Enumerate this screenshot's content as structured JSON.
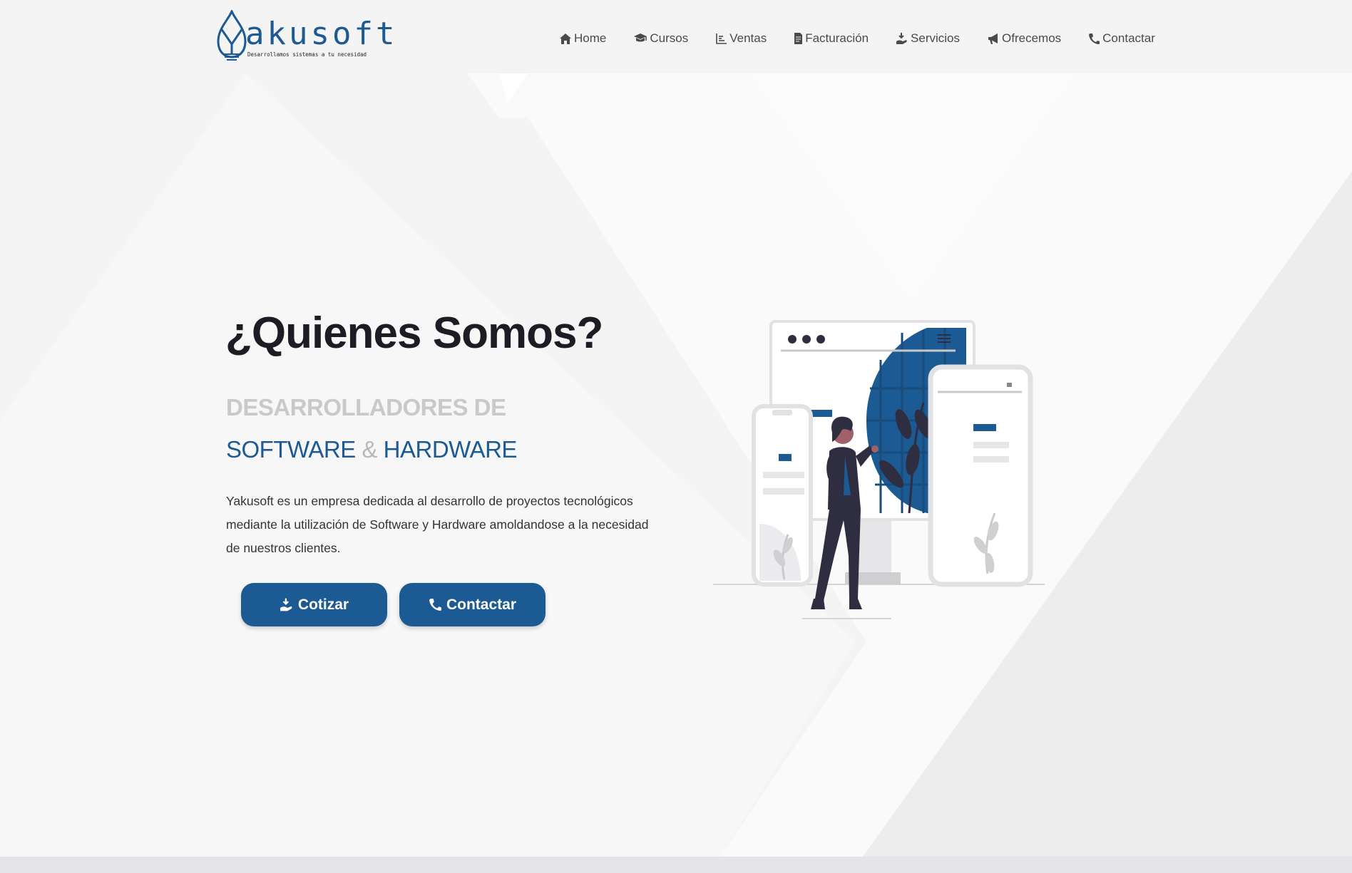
{
  "brand": {
    "name": "akusoft",
    "tagline": "Desarrollamos sistemas a tu necesidad"
  },
  "nav": {
    "items": [
      {
        "label": "Home",
        "icon": "home-icon"
      },
      {
        "label": "Cursos",
        "icon": "graduation-cap-icon"
      },
      {
        "label": "Ventas",
        "icon": "chart-icon"
      },
      {
        "label": "Facturación",
        "icon": "invoice-icon"
      },
      {
        "label": "Servicios",
        "icon": "hand-holding-icon"
      },
      {
        "label": "Ofrecemos",
        "icon": "megaphone-icon"
      },
      {
        "label": "Contactar",
        "icon": "phone-icon"
      }
    ]
  },
  "hero": {
    "title": "¿Quienes Somos?",
    "subtitle_line1": "DESARROLLADORES DE",
    "subtitle_software": "SOFTWARE",
    "subtitle_amp": "&",
    "subtitle_hardware": "HARDWARE",
    "description": "Yakusoft es un empresa dedicada al desarrollo de proyectos tecnológicos mediante la utilización de Software y Hardware amoldandose a la necesidad de nuestros clientes.",
    "btn_cotizar": "Cotizar",
    "btn_contactar": "Contactar"
  },
  "colors": {
    "accent": "#1c5a93",
    "title": "#1c1c24",
    "subtitle_gray": "#c9c9cc"
  }
}
